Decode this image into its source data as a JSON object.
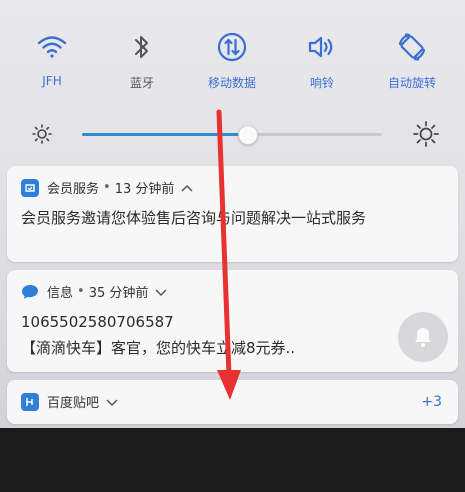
{
  "quick_settings": {
    "tiles": [
      {
        "label": "JFH",
        "icon": "wifi-icon",
        "active": true
      },
      {
        "label": "蓝牙",
        "icon": "bluetooth-icon",
        "active": false
      },
      {
        "label": "移动数据",
        "icon": "mobile-data-icon",
        "active": true
      },
      {
        "label": "响铃",
        "icon": "ring-icon",
        "active": true
      },
      {
        "label": "自动旋转",
        "icon": "auto-rotate-icon",
        "active": true
      }
    ],
    "brightness_level": 0.55
  },
  "notifications": [
    {
      "app": "会员服务",
      "time": "13 分钟前",
      "text": "会员服务邀请您体验售后咨询与问题解决一站式服务",
      "icon": "member-service-icon"
    },
    {
      "app": "信息",
      "time": "35 分钟前",
      "title": "1065502580706587",
      "text": "【滴滴快车】客官，您的快车立减8元券..",
      "icon": "message-icon"
    },
    {
      "app": "百度贴吧",
      "count": "+3",
      "icon": "tieba-icon"
    }
  ],
  "accent_color": "#3a6fd6"
}
